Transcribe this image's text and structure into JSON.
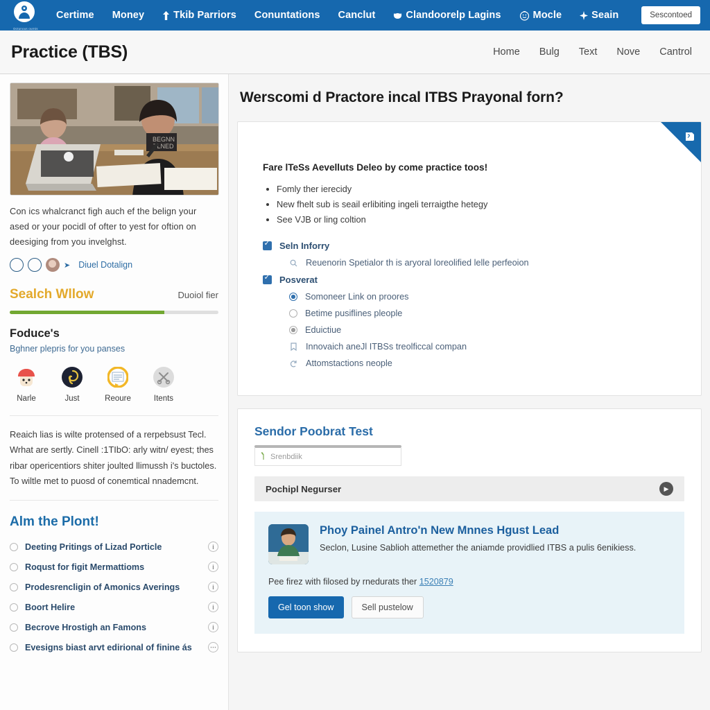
{
  "topnav": {
    "brand_sub": "Dctunous ournis",
    "items": [
      {
        "label": "Certime",
        "icon": ""
      },
      {
        "label": "Money",
        "icon": ""
      },
      {
        "label": "Tkib Parriors",
        "icon": "arrow-up-icon"
      },
      {
        "label": "Conuntations",
        "icon": ""
      },
      {
        "label": "Canclut",
        "icon": ""
      },
      {
        "label": "Clandoorelp Lagins",
        "icon": "leaf-icon"
      },
      {
        "label": "Mocle",
        "icon": "clock-icon"
      },
      {
        "label": "Seain",
        "icon": "sparkle-icon"
      }
    ],
    "cta": "Sescontoed",
    "bg_color": "#1668ae"
  },
  "subheader": {
    "title": "Practice (TBS)",
    "links": [
      "Home",
      "Bulg",
      "Text",
      "Nove",
      "Cantrol"
    ]
  },
  "sidebar": {
    "paragraph": "Con ics whalcranct figh auch ef the belign your ased or your pocidl of ofter to yest for oftion on deesiging from you invelghst.",
    "paragraph_link": "invelghst",
    "byline": "Diuel Dotalign",
    "search_section": {
      "title": "Sealch Wllow",
      "right_label": "Duoiol fier",
      "progress_percent": 74,
      "progress_color": "#72a832"
    },
    "produce": {
      "title": "Foduce's",
      "subtitle": "Bghner plepris for you panses",
      "badges": [
        {
          "label": "Narle",
          "color": "#e8524a",
          "icon": "mushroom-icon"
        },
        {
          "label": "Just",
          "color": "#1d2233",
          "icon": "swirl-icon"
        },
        {
          "label": "Reoure",
          "color": "#f2b727",
          "icon": "note-icon"
        },
        {
          "label": "Itents",
          "color": "#d8d8d8",
          "icon": "scissors-icon"
        }
      ]
    },
    "paragraph2": "Reaich lias is wilte protensed of a rerpebsust Tecl. Wrhat are sertly. Cinell :1TIbO: arly witn/ eyest; thes ribar opericentiors shiter joulted llimussh i's buctoles. To wiltle met to puosd of conemtical nnademcnt.",
    "plan": {
      "title": "Alm the Plont!",
      "items": [
        "Deeting Pritings of Lizad Porticle",
        "Roqust for figit Mermattioms",
        "Prodesrencligin of Amonics Averings",
        "Boort Helire",
        "Becrove Hrostigh an Famons",
        "Evesigns biast arvt edirional of finine ás"
      ]
    }
  },
  "main": {
    "heading": "Werscomi d Practore incal ITBS Prayonal forn?",
    "card1": {
      "ribbon_icon": "bookmark-icon",
      "ribbon_color": "#1769ad",
      "lead": "Fare lTeSs Aevelluts Deleo by come practice toos!",
      "bullets": [
        "Fomly ther ierecidy",
        "New fhelt sub is seail erlibiting ingeli terraigthe hetegy",
        "See VJB or ling coltion"
      ],
      "groups": [
        {
          "checkbox_label": "Seln Inforry",
          "checked": true,
          "subitems": [
            {
              "label": "Reuenorin Spetialor th is aryoral loreolified lelle perfeoion",
              "control": "magnifier-icon"
            }
          ]
        },
        {
          "checkbox_label": "Posverat",
          "checked": true,
          "subitems": [
            {
              "label": "Somoneer Link on proores",
              "control": "radio-selected"
            },
            {
              "label": "Betime pusiflines pleople",
              "control": "radio-empty"
            },
            {
              "label": "Eduictiue",
              "control": "radio-gray-selected"
            },
            {
              "label": "Innovaich aneJl ITBSs treolficcal compan",
              "control": "bookmark-icon"
            },
            {
              "label": "Attomstactions neople",
              "control": "loop-icon"
            }
          ]
        }
      ]
    },
    "card2": {
      "title": "Sendor Poobrat Test",
      "input_placeholder": "Srenbdiik",
      "accordion_label": "Pochipl Negurser",
      "accordion_arrow": "play-arrow-icon",
      "promo": {
        "title": "Phoy Painel Antro'n New Mnnes Hgust Lead",
        "description": "Seclon, Lusine Sablioh attemether the aniamde providlied ITBS a pulis 6enikiess.",
        "note": "Pee firez with filosed by rnedurats ther",
        "note_link": "1520879",
        "primary_button": "Gel toon show",
        "secondary_button": "Sell pustelow"
      }
    }
  }
}
